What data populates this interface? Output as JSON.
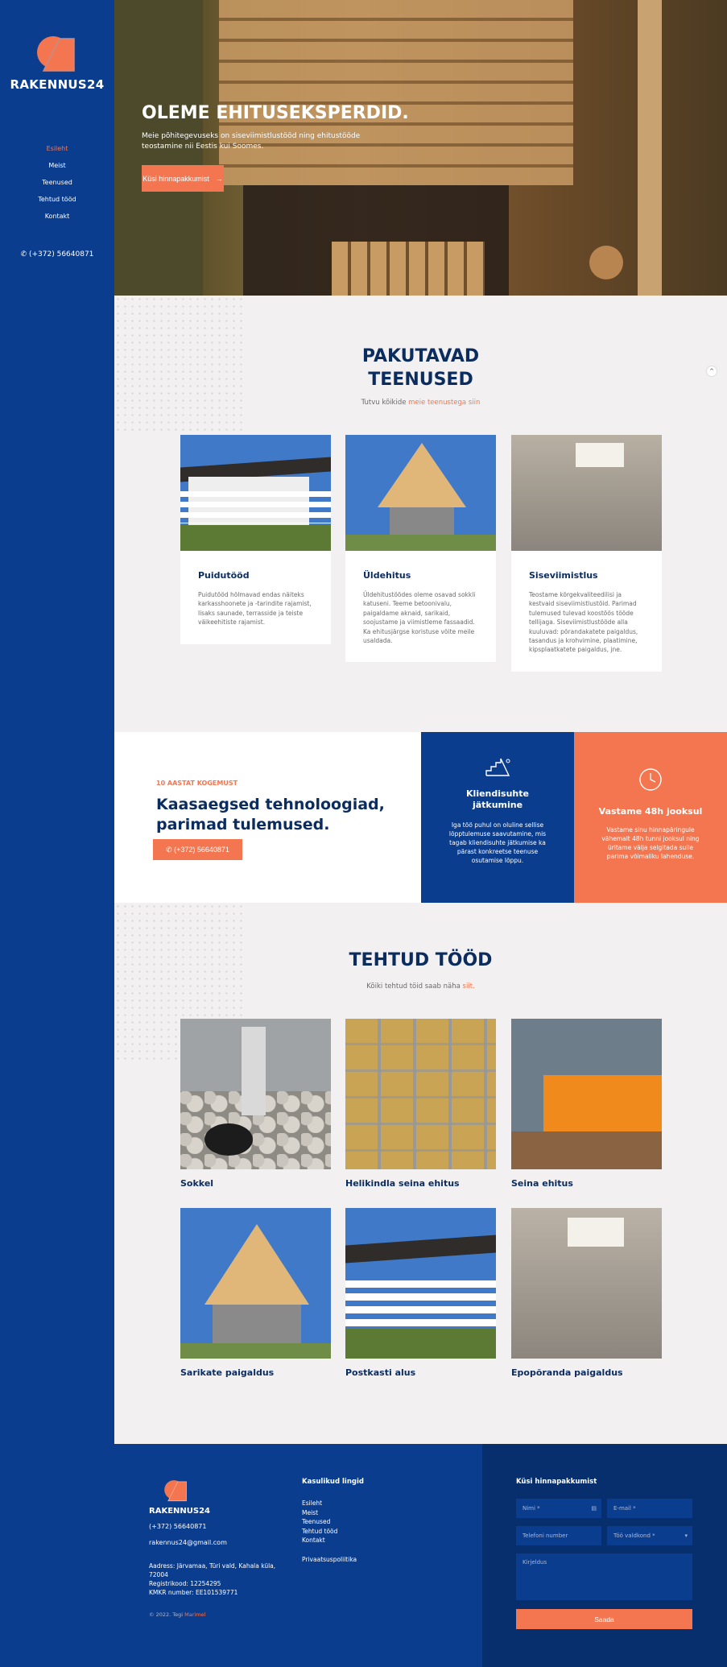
{
  "brand": {
    "name": "RAKENNUS24",
    "accent": "#f47650",
    "primary": "#0b3d8f",
    "dark": "#0b2c5f"
  },
  "nav": {
    "items": [
      "Esileht",
      "Meist",
      "Teenused",
      "Tehtud tööd",
      "Kontakt"
    ],
    "phone": "(+372) 56640871"
  },
  "hero": {
    "title": "OLEME EHITUSEKSPERDID.",
    "text": "Meie põhitegevuseks on siseviimistlustööd ning ehitustööde teostamine nii Eestis kui Soomes.",
    "button": "Küsi hinnapakkumist"
  },
  "services": {
    "title_line1": "PAKUTAVAD",
    "title_line2": "TEENUSED",
    "subtitle_pre": "Tutvu kõikide",
    "subtitle_link": "meie teenustega siin",
    "cards": [
      {
        "title": "Puidutööd",
        "text": "Puidutööd hõlmavad endas näiteks karkasshoonete ja -tarindite rajamist, lisaks saunade, terrasside ja teiste väikeehitiste rajamist."
      },
      {
        "title": "Üldehitus",
        "text": "Üldehitustöödes oleme osavad sokkli katuseni. Teeme betoonivalu, paigaldame aknaid, sarikaid, soojustame ja viimistleme fassaadid. Ka ehitusjärgse koristuse võite meile usaldada."
      },
      {
        "title": "Siseviimistlus",
        "text": "Teostame kõrgekvaliteedilisi ja kestvaid siseviimistlustöid. Parimad tulemused tulevad koostöös tööde tellijaga. Siseviimistlustööde alla kuuluvad: põrandakatete paigaldus, tasandus ja krohvimine, plaatimine, kipsplaatkatete paigaldus, jne."
      }
    ]
  },
  "experience": {
    "eyebrow": "10 AASTAT KOGEMUST",
    "heading_line1": "Kaasaegsed tehnoloogiad,",
    "heading_line2": "parimad tulemused.",
    "phone": "(+372) 56640871",
    "card1_title": "Kliendisuhte jätkumine",
    "card1_text": "Iga töö puhul on oluline sellise lõpptulemuse saavutamine, mis tagab kliendisuhte jätkumise ka pärast konkreetse teenuse osutamise lõppu.",
    "card2_title": "Vastame 48h jooksul",
    "card2_text": "Vastame sinu hinnapäringule vähemalt 48h tunni jooksul ning üritame välja selgitada sulle parima võimaliku lahenduse."
  },
  "works": {
    "title": "TEHTUD TÖÖD",
    "subtitle_pre": "Kõiki tehtud töid saab näha",
    "subtitle_link": "siit.",
    "items": [
      "Sokkel",
      "Helikindla seina ehitus",
      "Seina ehitus",
      "Sarikate paigaldus",
      "Postkasti alus",
      "Epopõranda paigaldus"
    ]
  },
  "footer": {
    "name": "RAKENNUS24",
    "phone": "(+372) 56640871",
    "email": "rakennus24@gmail.com",
    "address": "Aadress: Järvamaa, Türi vald, Kahala küla, 72004",
    "regcode": "Registrikood: 12254295",
    "kmkr": "KMKR number: EE101539771",
    "copyright_pre": "© 2022. Tegi",
    "copyright_link": "Marimel",
    "links_title": "Kasulikud lingid",
    "links": [
      "Esileht",
      "Meist",
      "Teenused",
      "Tehtud tööd",
      "Kontakt"
    ],
    "privacy": "Privaatsuspoliitika",
    "form_title": "Küsi hinnapakkumist",
    "ph_name": "Nimi *",
    "ph_email": "E-mail *",
    "ph_phone": "Telefoni number",
    "ph_field": "Töö valdkond *",
    "ph_desc": "Kirjeldus",
    "submit": "Saada"
  }
}
